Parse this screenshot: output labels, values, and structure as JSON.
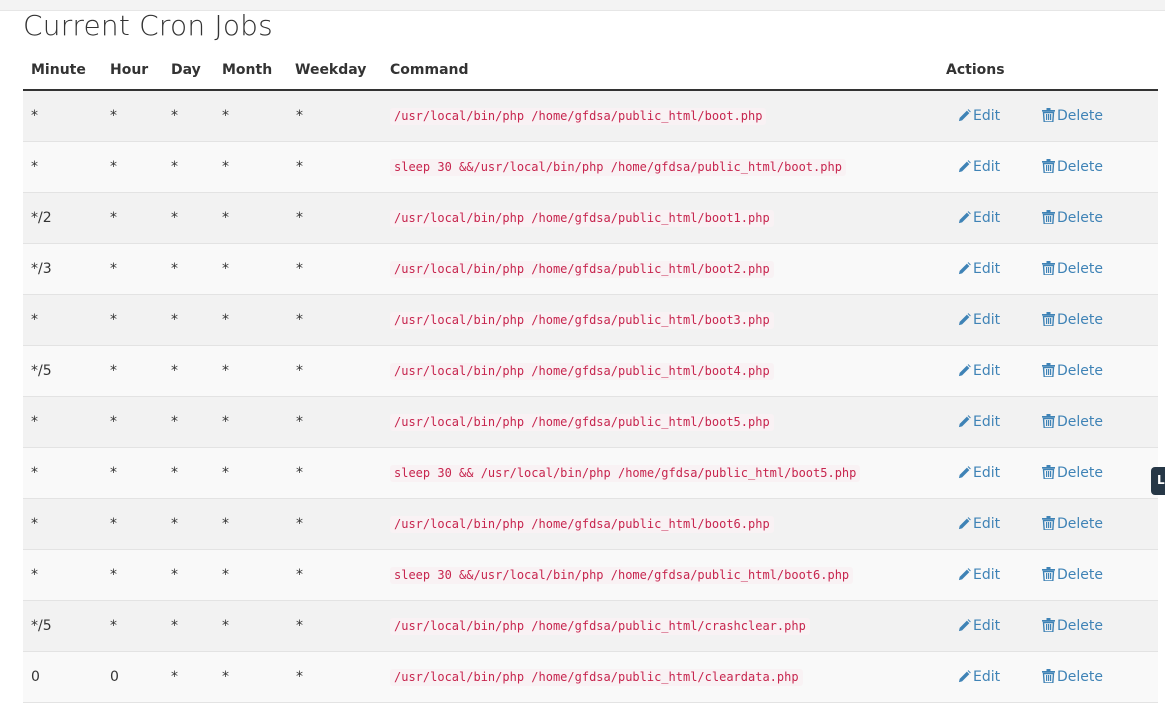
{
  "page": {
    "title": "Current Cron Jobs"
  },
  "table": {
    "headers": {
      "minute": "Minute",
      "hour": "Hour",
      "day": "Day",
      "month": "Month",
      "weekday": "Weekday",
      "command": "Command",
      "actions": "Actions"
    },
    "edit_label": "Edit",
    "delete_label": "Delete",
    "rows": [
      {
        "minute": "*",
        "hour": "*",
        "day": "*",
        "month": "*",
        "weekday": "*",
        "command": "/usr/local/bin/php /home/gfdsa/public_html/boot.php"
      },
      {
        "minute": "*",
        "hour": "*",
        "day": "*",
        "month": "*",
        "weekday": "*",
        "command": "sleep 30 &&/usr/local/bin/php /home/gfdsa/public_html/boot.php"
      },
      {
        "minute": "*/2",
        "hour": "*",
        "day": "*",
        "month": "*",
        "weekday": "*",
        "command": "/usr/local/bin/php /home/gfdsa/public_html/boot1.php"
      },
      {
        "minute": "*/3",
        "hour": "*",
        "day": "*",
        "month": "*",
        "weekday": "*",
        "command": "/usr/local/bin/php /home/gfdsa/public_html/boot2.php"
      },
      {
        "minute": "*",
        "hour": "*",
        "day": "*",
        "month": "*",
        "weekday": "*",
        "command": "/usr/local/bin/php /home/gfdsa/public_html/boot3.php"
      },
      {
        "minute": "*/5",
        "hour": "*",
        "day": "*",
        "month": "*",
        "weekday": "*",
        "command": "/usr/local/bin/php /home/gfdsa/public_html/boot4.php"
      },
      {
        "minute": "*",
        "hour": "*",
        "day": "*",
        "month": "*",
        "weekday": "*",
        "command": "/usr/local/bin/php /home/gfdsa/public_html/boot5.php"
      },
      {
        "minute": "*",
        "hour": "*",
        "day": "*",
        "month": "*",
        "weekday": "*",
        "command": "sleep 30 && /usr/local/bin/php /home/gfdsa/public_html/boot5.php"
      },
      {
        "minute": "*",
        "hour": "*",
        "day": "*",
        "month": "*",
        "weekday": "*",
        "command": "/usr/local/bin/php /home/gfdsa/public_html/boot6.php"
      },
      {
        "minute": "*",
        "hour": "*",
        "day": "*",
        "month": "*",
        "weekday": "*",
        "command": "sleep 30 &&/usr/local/bin/php /home/gfdsa/public_html/boot6.php"
      },
      {
        "minute": "*/5",
        "hour": "*",
        "day": "*",
        "month": "*",
        "weekday": "*",
        "command": "/usr/local/bin/php /home/gfdsa/public_html/crashclear.php"
      },
      {
        "minute": "0",
        "hour": "0",
        "day": "*",
        "month": "*",
        "weekday": "*",
        "command": "/usr/local/bin/php /home/gfdsa/public_html/cleardata.php"
      }
    ]
  },
  "side_tab": {
    "icon": "chat-tab-icon"
  },
  "colors": {
    "link": "#3f83b6",
    "code": "#c7254e",
    "code_bg": "#f9f2f4"
  }
}
